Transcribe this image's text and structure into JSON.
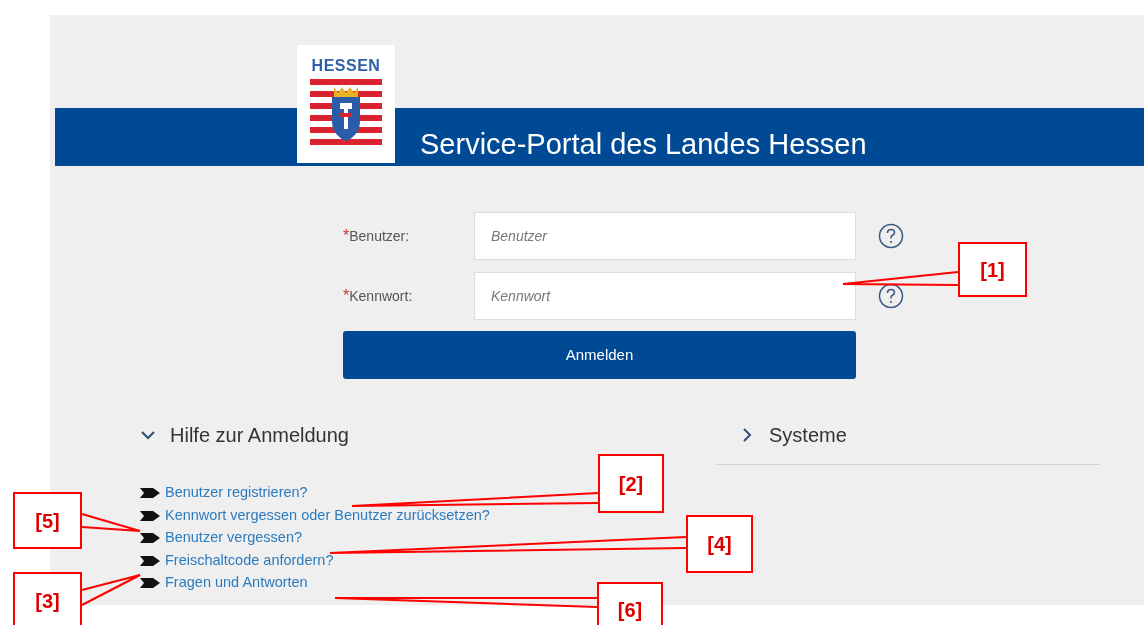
{
  "logo": {
    "text": "HESSEN"
  },
  "header": {
    "title": "Service-Portal des Landes Hessen"
  },
  "form": {
    "fields": [
      {
        "required_mark": "*",
        "label": "Benutzer:",
        "placeholder": "Benutzer"
      },
      {
        "required_mark": "*",
        "label": "Kennwort:",
        "placeholder": "Kennwort"
      }
    ],
    "submit": "Anmelden"
  },
  "sections": [
    {
      "title": "Hilfe zur Anmeldung",
      "expanded": true
    },
    {
      "title": "Systeme",
      "expanded": false
    }
  ],
  "help_links": [
    "Benutzer registrieren?",
    "Kennwort vergessen oder Benutzer zurücksetzen?",
    "Benutzer vergessen?",
    "Freischaltcode anfordern?",
    "Fragen und Antworten"
  ],
  "callouts": [
    {
      "label": "[1]"
    },
    {
      "label": "[2]"
    },
    {
      "label": "[5]"
    },
    {
      "label": "[4]"
    },
    {
      "label": "[3]"
    },
    {
      "label": "[6]"
    }
  ]
}
